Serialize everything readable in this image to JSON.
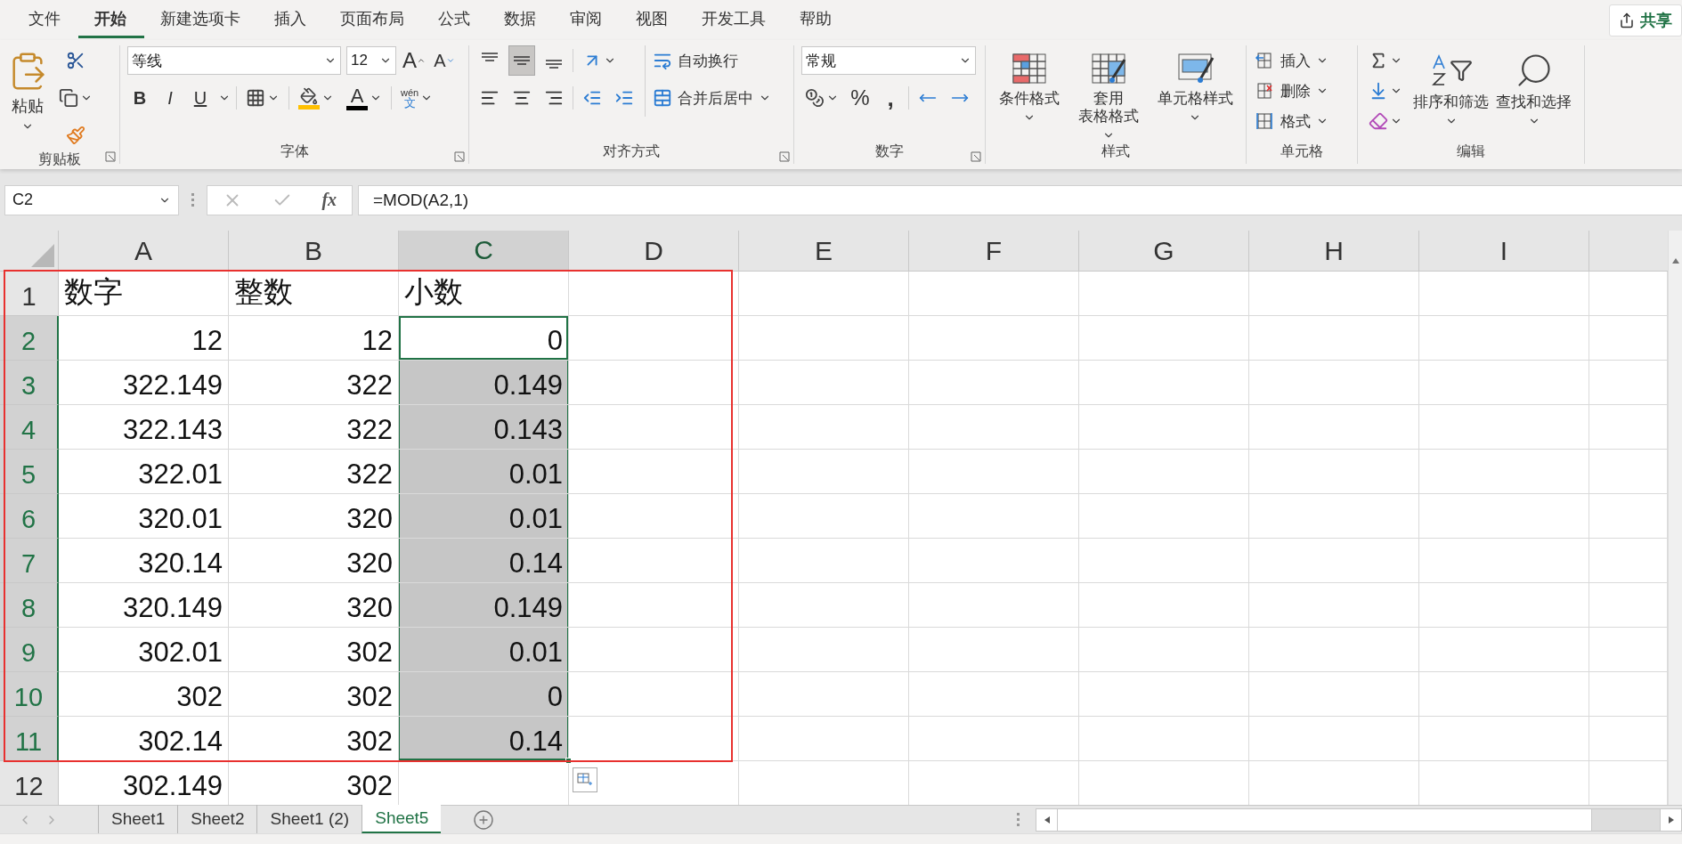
{
  "menu_tabs": [
    {
      "label": "文件",
      "selected": false
    },
    {
      "label": "开始",
      "selected": true
    },
    {
      "label": "新建选项卡",
      "selected": false
    },
    {
      "label": "插入",
      "selected": false
    },
    {
      "label": "页面布局",
      "selected": false
    },
    {
      "label": "公式",
      "selected": false
    },
    {
      "label": "数据",
      "selected": false
    },
    {
      "label": "审阅",
      "selected": false
    },
    {
      "label": "视图",
      "selected": false
    },
    {
      "label": "开发工具",
      "selected": false
    },
    {
      "label": "帮助",
      "selected": false
    }
  ],
  "share_button": {
    "label": "共享"
  },
  "clipboard": {
    "label": "剪贴板",
    "paste": "粘贴"
  },
  "font": {
    "label": "字体",
    "font_name": "等线",
    "font_size": "12",
    "grow": "A",
    "shrink": "A",
    "bold": "B",
    "italic": "I",
    "underline": "U",
    "font_color": "A",
    "phonetic_top": "wén",
    "phonetic_bottom": "文"
  },
  "alignment": {
    "label": "对齐方式",
    "vertical": [
      {
        "kind": "top",
        "selected": false
      },
      {
        "kind": "middle",
        "selected": true
      },
      {
        "kind": "bottom",
        "selected": false
      }
    ],
    "wrap": "自动换行",
    "merge": "合并后居中"
  },
  "number": {
    "label": "数字",
    "format": "常规",
    "percent": "%",
    "comma": ","
  },
  "styles": {
    "label": "样式",
    "buttons": [
      {
        "kind": "conditional",
        "lines": [
          "条件格式"
        ]
      },
      {
        "kind": "table",
        "lines": [
          "套用",
          "表格格式"
        ]
      },
      {
        "kind": "cell",
        "lines": [
          "单元格样式"
        ]
      }
    ]
  },
  "cells": {
    "label": "单元格",
    "buttons": [
      {
        "kind": "insert",
        "label": "插入"
      },
      {
        "kind": "delete",
        "label": "删除"
      },
      {
        "kind": "format",
        "label": "格式"
      }
    ]
  },
  "editing": {
    "label": "编辑",
    "buttons": [
      {
        "kind": "sort",
        "label": "排序和筛选"
      },
      {
        "kind": "find",
        "label": "查找和选择"
      }
    ]
  },
  "formula_bar": {
    "name_box": "C2",
    "fx": "fx",
    "formula": "=MOD(A2,1)"
  },
  "sheet": {
    "columns": [
      {
        "label": "A",
        "selected": false
      },
      {
        "label": "B",
        "selected": false
      },
      {
        "label": "C",
        "selected": true
      },
      {
        "label": "D",
        "selected": false
      },
      {
        "label": "E",
        "selected": false
      },
      {
        "label": "F",
        "selected": false
      },
      {
        "label": "G",
        "selected": false
      },
      {
        "label": "H",
        "selected": false
      },
      {
        "label": "I",
        "selected": false
      }
    ],
    "rows": [
      {
        "number": "1",
        "selected": false,
        "kind": "label",
        "cells": [
          {
            "text": "数字",
            "selected": false,
            "active": false
          },
          {
            "text": "整数",
            "selected": false,
            "active": false
          },
          {
            "text": "小数",
            "selected": false,
            "active": false
          }
        ]
      },
      {
        "number": "2",
        "selected": true,
        "kind": "value",
        "cells": [
          {
            "text": "12",
            "selected": false,
            "active": false
          },
          {
            "text": "12",
            "selected": false,
            "active": false
          },
          {
            "text": "0",
            "selected": true,
            "active": true
          }
        ]
      },
      {
        "number": "3",
        "selected": true,
        "kind": "value",
        "cells": [
          {
            "text": "322.149",
            "selected": false,
            "active": false
          },
          {
            "text": "322",
            "selected": false,
            "active": false
          },
          {
            "text": "0.149",
            "selected": true,
            "active": false
          }
        ]
      },
      {
        "number": "4",
        "selected": true,
        "kind": "value",
        "cells": [
          {
            "text": "322.143",
            "selected": false,
            "active": false
          },
          {
            "text": "322",
            "selected": false,
            "active": false
          },
          {
            "text": "0.143",
            "selected": true,
            "active": false
          }
        ]
      },
      {
        "number": "5",
        "selected": true,
        "kind": "value",
        "cells": [
          {
            "text": "322.01",
            "selected": false,
            "active": false
          },
          {
            "text": "322",
            "selected": false,
            "active": false
          },
          {
            "text": "0.01",
            "selected": true,
            "active": false
          }
        ]
      },
      {
        "number": "6",
        "selected": true,
        "kind": "value",
        "cells": [
          {
            "text": "320.01",
            "selected": false,
            "active": false
          },
          {
            "text": "320",
            "selected": false,
            "active": false
          },
          {
            "text": "0.01",
            "selected": true,
            "active": false
          }
        ]
      },
      {
        "number": "7",
        "selected": true,
        "kind": "value",
        "cells": [
          {
            "text": "320.14",
            "selected": false,
            "active": false
          },
          {
            "text": "320",
            "selected": false,
            "active": false
          },
          {
            "text": "0.14",
            "selected": true,
            "active": false
          }
        ]
      },
      {
        "number": "8",
        "selected": true,
        "kind": "value",
        "cells": [
          {
            "text": "320.149",
            "selected": false,
            "active": false
          },
          {
            "text": "320",
            "selected": false,
            "active": false
          },
          {
            "text": "0.149",
            "selected": true,
            "active": false
          }
        ]
      },
      {
        "number": "9",
        "selected": true,
        "kind": "value",
        "cells": [
          {
            "text": "302.01",
            "selected": false,
            "active": false
          },
          {
            "text": "302",
            "selected": false,
            "active": false
          },
          {
            "text": "0.01",
            "selected": true,
            "active": false
          }
        ]
      },
      {
        "number": "10",
        "selected": true,
        "kind": "value",
        "cells": [
          {
            "text": "302",
            "selected": false,
            "active": false
          },
          {
            "text": "302",
            "selected": false,
            "active": false
          },
          {
            "text": "0",
            "selected": true,
            "active": false
          }
        ]
      },
      {
        "number": "11",
        "selected": true,
        "kind": "value",
        "cells": [
          {
            "text": "302.14",
            "selected": false,
            "active": false
          },
          {
            "text": "302",
            "selected": false,
            "active": false
          },
          {
            "text": "0.14",
            "selected": true,
            "active": false
          }
        ]
      },
      {
        "number": "12",
        "selected": false,
        "kind": "value",
        "cells": [
          {
            "text": "302.149",
            "selected": false,
            "active": false
          },
          {
            "text": "302",
            "selected": false,
            "active": false
          }
        ]
      }
    ]
  },
  "sheet_tabs": [
    {
      "label": "Sheet1",
      "selected": false
    },
    {
      "label": "Sheet2",
      "selected": false
    },
    {
      "label": "Sheet1 (2)",
      "selected": false
    },
    {
      "label": "Sheet5",
      "selected": true
    }
  ]
}
